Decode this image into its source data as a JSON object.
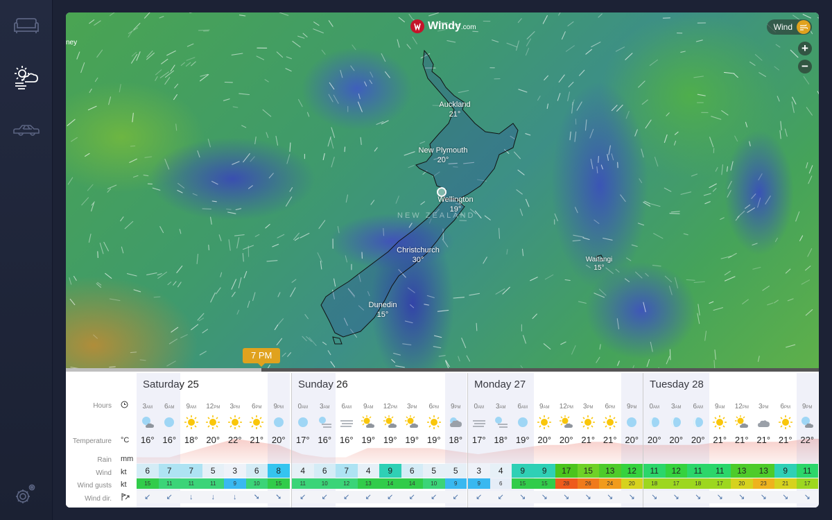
{
  "sidebar": {
    "items": [
      {
        "name": "sofa-icon"
      },
      {
        "name": "weather-icon"
      },
      {
        "name": "car-icon"
      }
    ],
    "settings": {
      "name": "settings-gear-icon"
    }
  },
  "map": {
    "brand": {
      "name": "Windy",
      "suffix": ".com"
    },
    "layer_button": {
      "label": "Wind",
      "icon": "wind-icon"
    },
    "zoom_in": "+",
    "zoom_out": "−",
    "corner_label": "ney",
    "country_label": "NEW ZEALAND",
    "cities": [
      {
        "name": "Auckland",
        "temp": "21°"
      },
      {
        "name": "New Plymouth",
        "temp": "20°"
      },
      {
        "name": "Wellington",
        "temp": "19°"
      },
      {
        "name": "Christchurch",
        "temp": "30°"
      },
      {
        "name": "Dunedin",
        "temp": "15°"
      },
      {
        "name": "Waitangi",
        "temp": "15°"
      }
    ],
    "time_tooltip": "7 PM",
    "timeline_progress": 0.26
  },
  "forecast": {
    "row_labels": {
      "hours": "Hours",
      "temperature": "Temperature",
      "temperature_unit": "°C",
      "rain": "Rain",
      "rain_unit": "mm",
      "wind": "Wind",
      "wind_unit": "kt",
      "gusts": "Wind gusts",
      "gusts_unit": "kt",
      "dir": "Wind dir."
    },
    "days": [
      {
        "name": "Saturday 25",
        "hours": [
          {
            "h": "3",
            "ap": "AM",
            "icon": "night-partly-cloudy",
            "temp": "16°",
            "wind": "6",
            "gust": "15",
            "dir": "↙"
          },
          {
            "h": "6",
            "ap": "AM",
            "icon": "clear-night",
            "temp": "16°",
            "wind": "7",
            "gust": "11",
            "dir": "↙"
          },
          {
            "h": "9",
            "ap": "AM",
            "icon": "sun",
            "temp": "18°",
            "wind": "7",
            "gust": "11",
            "dir": "↓"
          },
          {
            "h": "12",
            "ap": "PM",
            "icon": "sun",
            "temp": "20°",
            "wind": "5",
            "gust": "11",
            "dir": "↓"
          },
          {
            "h": "3",
            "ap": "PM",
            "icon": "sun",
            "temp": "22°",
            "wind": "3",
            "gust": "9",
            "dir": "↓"
          },
          {
            "h": "6",
            "ap": "PM",
            "icon": "sun",
            "temp": "21°",
            "wind": "6",
            "gust": "10",
            "dir": "➘"
          },
          {
            "h": "9",
            "ap": "PM",
            "icon": "clear-night",
            "temp": "20°",
            "wind": "8",
            "gust": "15",
            "dir": "➘"
          }
        ]
      },
      {
        "name": "Sunday 26",
        "hours": [
          {
            "h": "0",
            "ap": "AM",
            "icon": "clear-night",
            "temp": "17°",
            "wind": "4",
            "gust": "11",
            "dir": "↙"
          },
          {
            "h": "3",
            "ap": "AM",
            "icon": "night-fog",
            "temp": "16°",
            "wind": "6",
            "gust": "10",
            "dir": "↙"
          },
          {
            "h": "6",
            "ap": "AM",
            "icon": "fog",
            "temp": "16°",
            "wind": "7",
            "gust": "12",
            "dir": "↙"
          },
          {
            "h": "9",
            "ap": "AM",
            "icon": "sun-cloud",
            "temp": "19°",
            "wind": "4",
            "gust": "13",
            "dir": "↙"
          },
          {
            "h": "12",
            "ap": "PM",
            "icon": "sun-cloud",
            "temp": "19°",
            "wind": "9",
            "gust": "14",
            "dir": "↙"
          },
          {
            "h": "3",
            "ap": "PM",
            "icon": "sun-cloud",
            "temp": "19°",
            "wind": "6",
            "gust": "14",
            "dir": "↙"
          },
          {
            "h": "6",
            "ap": "PM",
            "icon": "sun",
            "temp": "19°",
            "wind": "5",
            "gust": "10",
            "dir": "↙"
          },
          {
            "h": "9",
            "ap": "PM",
            "icon": "night-cloudy",
            "temp": "18°",
            "wind": "5",
            "gust": "9",
            "dir": "↙"
          }
        ]
      },
      {
        "name": "Monday 27",
        "hours": [
          {
            "h": "0",
            "ap": "AM",
            "icon": "fog",
            "temp": "17°",
            "wind": "3",
            "gust": "9",
            "dir": "↙"
          },
          {
            "h": "3",
            "ap": "AM",
            "icon": "night-fog",
            "temp": "18°",
            "wind": "4",
            "gust": "6",
            "dir": "↙"
          },
          {
            "h": "6",
            "ap": "AM",
            "icon": "clear-night",
            "temp": "19°",
            "wind": "9",
            "gust": "15",
            "dir": "↘"
          },
          {
            "h": "9",
            "ap": "AM",
            "icon": "sun",
            "temp": "20°",
            "wind": "9",
            "gust": "15",
            "dir": "↘"
          },
          {
            "h": "12",
            "ap": "PM",
            "icon": "sun-cloud",
            "temp": "20°",
            "wind": "17",
            "gust": "28",
            "dir": "↘"
          },
          {
            "h": "3",
            "ap": "PM",
            "icon": "sun",
            "temp": "21°",
            "wind": "15",
            "gust": "26",
            "dir": "↘"
          },
          {
            "h": "6",
            "ap": "PM",
            "icon": "sun",
            "temp": "21°",
            "wind": "13",
            "gust": "24",
            "dir": "↘"
          },
          {
            "h": "9",
            "ap": "PM",
            "icon": "clear-night",
            "temp": "20°",
            "wind": "12",
            "gust": "20",
            "dir": "↘"
          }
        ]
      },
      {
        "name": "Tuesday 28",
        "hours": [
          {
            "h": "0",
            "ap": "AM",
            "icon": "moon-half",
            "temp": "20°",
            "wind": "11",
            "gust": "18",
            "dir": "↘"
          },
          {
            "h": "3",
            "ap": "AM",
            "icon": "moon-half",
            "temp": "20°",
            "wind": "12",
            "gust": "17",
            "dir": "↘"
          },
          {
            "h": "6",
            "ap": "AM",
            "icon": "moon-half",
            "temp": "20°",
            "wind": "11",
            "gust": "18",
            "dir": "↘"
          },
          {
            "h": "9",
            "ap": "AM",
            "icon": "sun",
            "temp": "21°",
            "wind": "11",
            "gust": "17",
            "dir": "↘"
          },
          {
            "h": "12",
            "ap": "PM",
            "icon": "sun-cloud",
            "temp": "21°",
            "wind": "13",
            "gust": "20",
            "dir": "↘"
          },
          {
            "h": "3",
            "ap": "PM",
            "icon": "cloudy",
            "temp": "21°",
            "wind": "13",
            "gust": "23",
            "dir": "↘"
          },
          {
            "h": "6",
            "ap": "PM",
            "icon": "sun",
            "temp": "21°",
            "wind": "9",
            "gust": "21",
            "dir": "↘"
          },
          {
            "h": "9",
            "ap": "PM",
            "icon": "night-partly-cloudy",
            "temp": "22°",
            "wind": "11",
            "gust": "17",
            "dir": "↘"
          }
        ]
      }
    ]
  }
}
